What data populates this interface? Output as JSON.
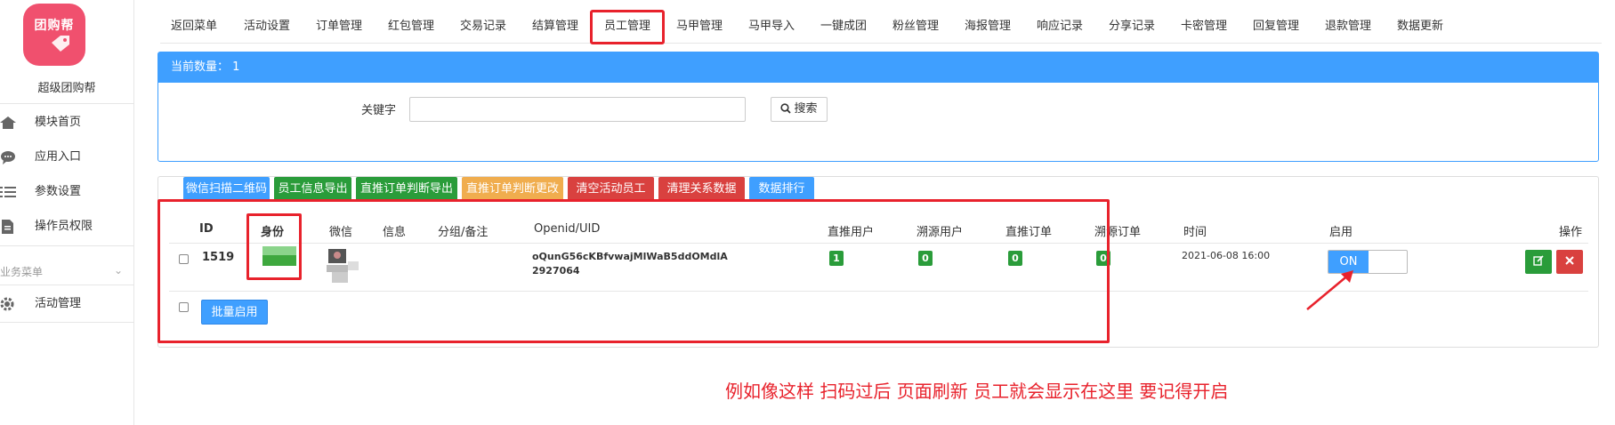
{
  "sidebar": {
    "logo_text": "团购帮",
    "app_name": "超级团购帮",
    "items": [
      {
        "label": "模块首页",
        "icon": "home-icon"
      },
      {
        "label": "应用入口",
        "icon": "chat-icon"
      },
      {
        "label": "参数设置",
        "icon": "list-icon"
      },
      {
        "label": "操作员权限",
        "icon": "file-icon"
      }
    ],
    "section_label": "业务菜单",
    "section_items": [
      {
        "label": "活动管理",
        "icon": "gear-icon"
      }
    ]
  },
  "tabs": [
    "返回菜单",
    "活动设置",
    "订单管理",
    "红包管理",
    "交易记录",
    "结算管理",
    "员工管理",
    "马甲管理",
    "马甲导入",
    "一键成团",
    "粉丝管理",
    "海报管理",
    "响应记录",
    "分享记录",
    "卡密管理",
    "回复管理",
    "退款管理",
    "数据更新"
  ],
  "active_tab_index": 6,
  "search_panel": {
    "header": "当前数量：  1",
    "keyword_label": "关键字",
    "keyword_value": "",
    "search_button": "搜索"
  },
  "action_buttons": [
    {
      "label": "微信扫描二维码",
      "color": "#3f9fff"
    },
    {
      "label": "员工信息导出",
      "color": "#2a9c3a"
    },
    {
      "label": "直推订单判断导出",
      "color": "#2a9c3a"
    },
    {
      "label": "直推订单判断更改",
      "color": "#f0ad4e"
    },
    {
      "label": "清空活动员工",
      "color": "#d9413f"
    },
    {
      "label": "清理关系数据",
      "color": "#d9413f"
    },
    {
      "label": "数据排行",
      "color": "#3f9fff"
    }
  ],
  "table": {
    "headers": [
      "ID",
      "身份",
      "微信",
      "信息",
      "分组/备注",
      "Openid/UID",
      "直推用户",
      "溯源用户",
      "直推订单",
      "溯源订单",
      "时间",
      "启用",
      "操作"
    ],
    "rows": [
      {
        "id": "1519",
        "openid_line1": "oQunG56cKBfvwajMlWaB5ddOMdlA",
        "openid_line2": "2927064",
        "direct_users": "1",
        "source_users": "0",
        "direct_orders": "0",
        "source_orders": "0",
        "time": "2021-06-08 16:00",
        "enabled_label": "ON"
      }
    ],
    "bulk_enable_button": "批量启用"
  },
  "annotation": "例如像这样  扫码过后  页面刷新 员工就会显示在这里   要记得开启",
  "colors": {
    "primary": "#3f9fff",
    "success": "#2a9c3a",
    "danger": "#d9413f",
    "warning": "#f0ad4e",
    "highlight": "#e8222c"
  }
}
